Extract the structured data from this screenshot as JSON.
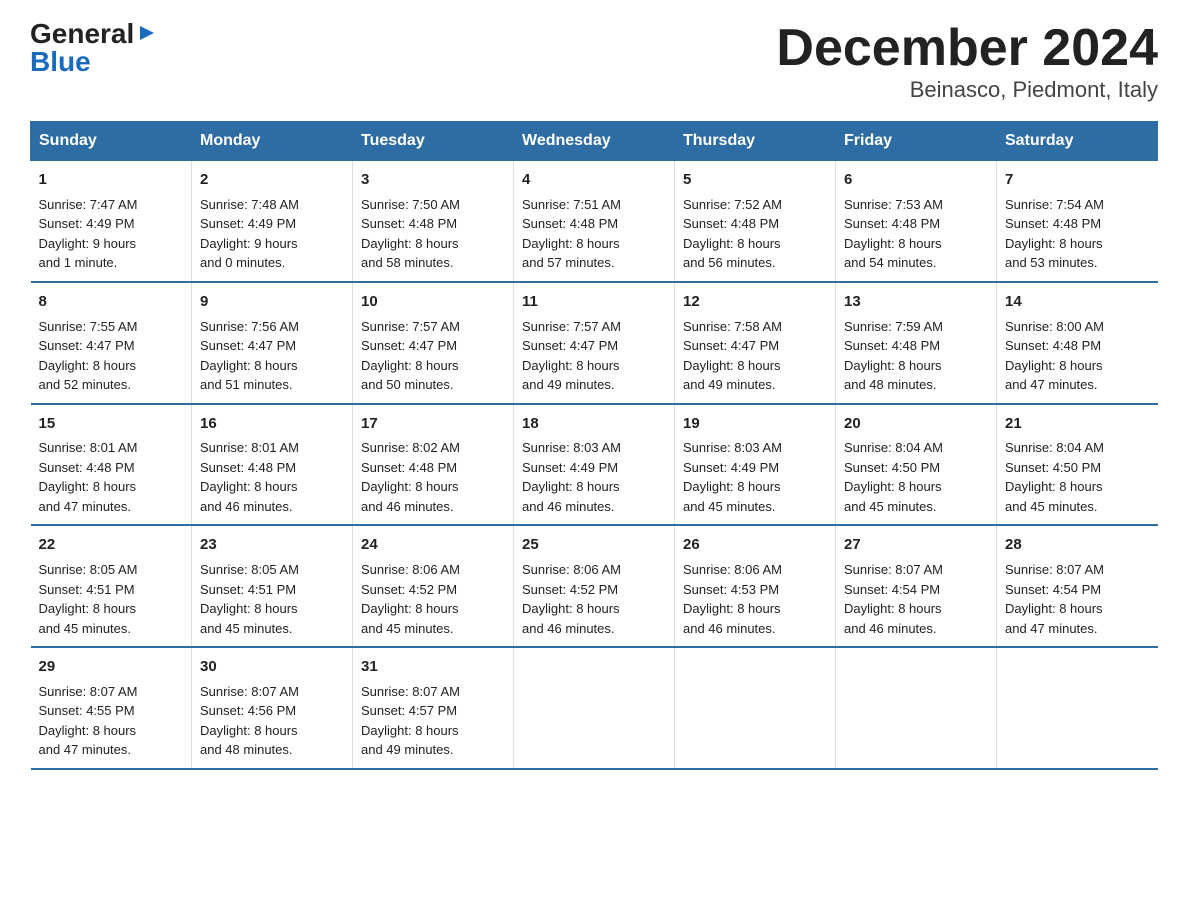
{
  "header": {
    "logo_general": "General",
    "logo_blue": "Blue",
    "title": "December 2024",
    "subtitle": "Beinasco, Piedmont, Italy"
  },
  "days_of_week": [
    "Sunday",
    "Monday",
    "Tuesday",
    "Wednesday",
    "Thursday",
    "Friday",
    "Saturday"
  ],
  "weeks": [
    [
      {
        "num": "1",
        "info": "Sunrise: 7:47 AM\nSunset: 4:49 PM\nDaylight: 9 hours\nand 1 minute."
      },
      {
        "num": "2",
        "info": "Sunrise: 7:48 AM\nSunset: 4:49 PM\nDaylight: 9 hours\nand 0 minutes."
      },
      {
        "num": "3",
        "info": "Sunrise: 7:50 AM\nSunset: 4:48 PM\nDaylight: 8 hours\nand 58 minutes."
      },
      {
        "num": "4",
        "info": "Sunrise: 7:51 AM\nSunset: 4:48 PM\nDaylight: 8 hours\nand 57 minutes."
      },
      {
        "num": "5",
        "info": "Sunrise: 7:52 AM\nSunset: 4:48 PM\nDaylight: 8 hours\nand 56 minutes."
      },
      {
        "num": "6",
        "info": "Sunrise: 7:53 AM\nSunset: 4:48 PM\nDaylight: 8 hours\nand 54 minutes."
      },
      {
        "num": "7",
        "info": "Sunrise: 7:54 AM\nSunset: 4:48 PM\nDaylight: 8 hours\nand 53 minutes."
      }
    ],
    [
      {
        "num": "8",
        "info": "Sunrise: 7:55 AM\nSunset: 4:47 PM\nDaylight: 8 hours\nand 52 minutes."
      },
      {
        "num": "9",
        "info": "Sunrise: 7:56 AM\nSunset: 4:47 PM\nDaylight: 8 hours\nand 51 minutes."
      },
      {
        "num": "10",
        "info": "Sunrise: 7:57 AM\nSunset: 4:47 PM\nDaylight: 8 hours\nand 50 minutes."
      },
      {
        "num": "11",
        "info": "Sunrise: 7:57 AM\nSunset: 4:47 PM\nDaylight: 8 hours\nand 49 minutes."
      },
      {
        "num": "12",
        "info": "Sunrise: 7:58 AM\nSunset: 4:47 PM\nDaylight: 8 hours\nand 49 minutes."
      },
      {
        "num": "13",
        "info": "Sunrise: 7:59 AM\nSunset: 4:48 PM\nDaylight: 8 hours\nand 48 minutes."
      },
      {
        "num": "14",
        "info": "Sunrise: 8:00 AM\nSunset: 4:48 PM\nDaylight: 8 hours\nand 47 minutes."
      }
    ],
    [
      {
        "num": "15",
        "info": "Sunrise: 8:01 AM\nSunset: 4:48 PM\nDaylight: 8 hours\nand 47 minutes."
      },
      {
        "num": "16",
        "info": "Sunrise: 8:01 AM\nSunset: 4:48 PM\nDaylight: 8 hours\nand 46 minutes."
      },
      {
        "num": "17",
        "info": "Sunrise: 8:02 AM\nSunset: 4:48 PM\nDaylight: 8 hours\nand 46 minutes."
      },
      {
        "num": "18",
        "info": "Sunrise: 8:03 AM\nSunset: 4:49 PM\nDaylight: 8 hours\nand 46 minutes."
      },
      {
        "num": "19",
        "info": "Sunrise: 8:03 AM\nSunset: 4:49 PM\nDaylight: 8 hours\nand 45 minutes."
      },
      {
        "num": "20",
        "info": "Sunrise: 8:04 AM\nSunset: 4:50 PM\nDaylight: 8 hours\nand 45 minutes."
      },
      {
        "num": "21",
        "info": "Sunrise: 8:04 AM\nSunset: 4:50 PM\nDaylight: 8 hours\nand 45 minutes."
      }
    ],
    [
      {
        "num": "22",
        "info": "Sunrise: 8:05 AM\nSunset: 4:51 PM\nDaylight: 8 hours\nand 45 minutes."
      },
      {
        "num": "23",
        "info": "Sunrise: 8:05 AM\nSunset: 4:51 PM\nDaylight: 8 hours\nand 45 minutes."
      },
      {
        "num": "24",
        "info": "Sunrise: 8:06 AM\nSunset: 4:52 PM\nDaylight: 8 hours\nand 45 minutes."
      },
      {
        "num": "25",
        "info": "Sunrise: 8:06 AM\nSunset: 4:52 PM\nDaylight: 8 hours\nand 46 minutes."
      },
      {
        "num": "26",
        "info": "Sunrise: 8:06 AM\nSunset: 4:53 PM\nDaylight: 8 hours\nand 46 minutes."
      },
      {
        "num": "27",
        "info": "Sunrise: 8:07 AM\nSunset: 4:54 PM\nDaylight: 8 hours\nand 46 minutes."
      },
      {
        "num": "28",
        "info": "Sunrise: 8:07 AM\nSunset: 4:54 PM\nDaylight: 8 hours\nand 47 minutes."
      }
    ],
    [
      {
        "num": "29",
        "info": "Sunrise: 8:07 AM\nSunset: 4:55 PM\nDaylight: 8 hours\nand 47 minutes."
      },
      {
        "num": "30",
        "info": "Sunrise: 8:07 AM\nSunset: 4:56 PM\nDaylight: 8 hours\nand 48 minutes."
      },
      {
        "num": "31",
        "info": "Sunrise: 8:07 AM\nSunset: 4:57 PM\nDaylight: 8 hours\nand 49 minutes."
      },
      null,
      null,
      null,
      null
    ]
  ]
}
